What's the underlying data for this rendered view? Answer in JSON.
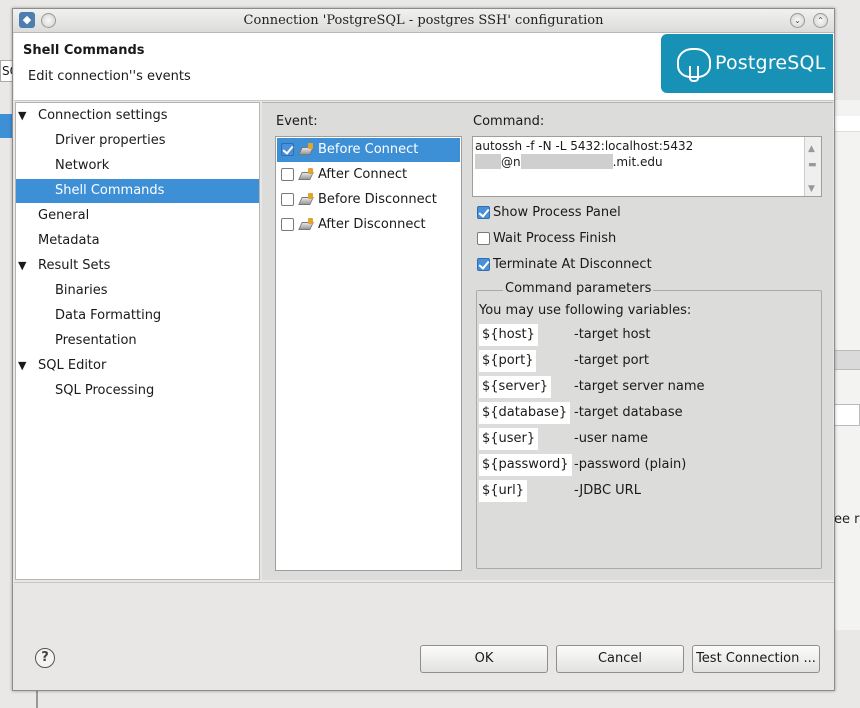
{
  "background": {
    "left_text": "SQ",
    "right_text": "ee re"
  },
  "window": {
    "title": "Connection 'PostgreSQL - postgres SSH' configuration"
  },
  "header": {
    "title": "Shell Commands",
    "subtitle": "Edit connection''s events",
    "logo_text": "PostgreSQL"
  },
  "nav": {
    "items": [
      {
        "label": "Connection settings",
        "level": 0,
        "expanded": true
      },
      {
        "label": "Driver properties",
        "level": 1
      },
      {
        "label": "Network",
        "level": 1
      },
      {
        "label": "Shell Commands",
        "level": 1,
        "selected": true
      },
      {
        "label": "General",
        "level": 0
      },
      {
        "label": "Metadata",
        "level": 0
      },
      {
        "label": "Result Sets",
        "level": 0,
        "expanded": true
      },
      {
        "label": "Binaries",
        "level": 1
      },
      {
        "label": "Data Formatting",
        "level": 1
      },
      {
        "label": "Presentation",
        "level": 1
      },
      {
        "label": "SQL Editor",
        "level": 0,
        "expanded": true
      },
      {
        "label": "SQL Processing",
        "level": 1
      }
    ]
  },
  "events": {
    "label": "Event:",
    "items": [
      {
        "label": "Before Connect",
        "checked": true,
        "selected": true
      },
      {
        "label": "After Connect",
        "checked": false
      },
      {
        "label": "Before Disconnect",
        "checked": false
      },
      {
        "label": "After Disconnect",
        "checked": false
      }
    ]
  },
  "command": {
    "label": "Command:",
    "line1": "autossh -f -N -L 5432:localhost:5432",
    "line2_part1": "@n",
    "line2_part2": ".mit.edu"
  },
  "options": [
    {
      "label": "Show Process Panel",
      "checked": true
    },
    {
      "label": "Wait Process Finish",
      "checked": false
    },
    {
      "label": "Terminate At Disconnect",
      "checked": true
    }
  ],
  "params": {
    "title": "Command parameters",
    "intro": "You may use following variables:",
    "rows": [
      {
        "var": "${host}",
        "desc": "-target host"
      },
      {
        "var": "${port}",
        "desc": "-target port"
      },
      {
        "var": "${server}",
        "desc": "-target server name"
      },
      {
        "var": "${database}",
        "desc": "-target database"
      },
      {
        "var": "${user}",
        "desc": "-user name"
      },
      {
        "var": "${password}",
        "desc": "-password (plain)"
      },
      {
        "var": "${url}",
        "desc": "-JDBC URL"
      }
    ]
  },
  "buttons": {
    "help": "?",
    "ok": "OK",
    "cancel": "Cancel",
    "test": "Test Connection ..."
  },
  "colors": {
    "selection": "#3d8fd6",
    "logo_bg": "#1792b6"
  }
}
